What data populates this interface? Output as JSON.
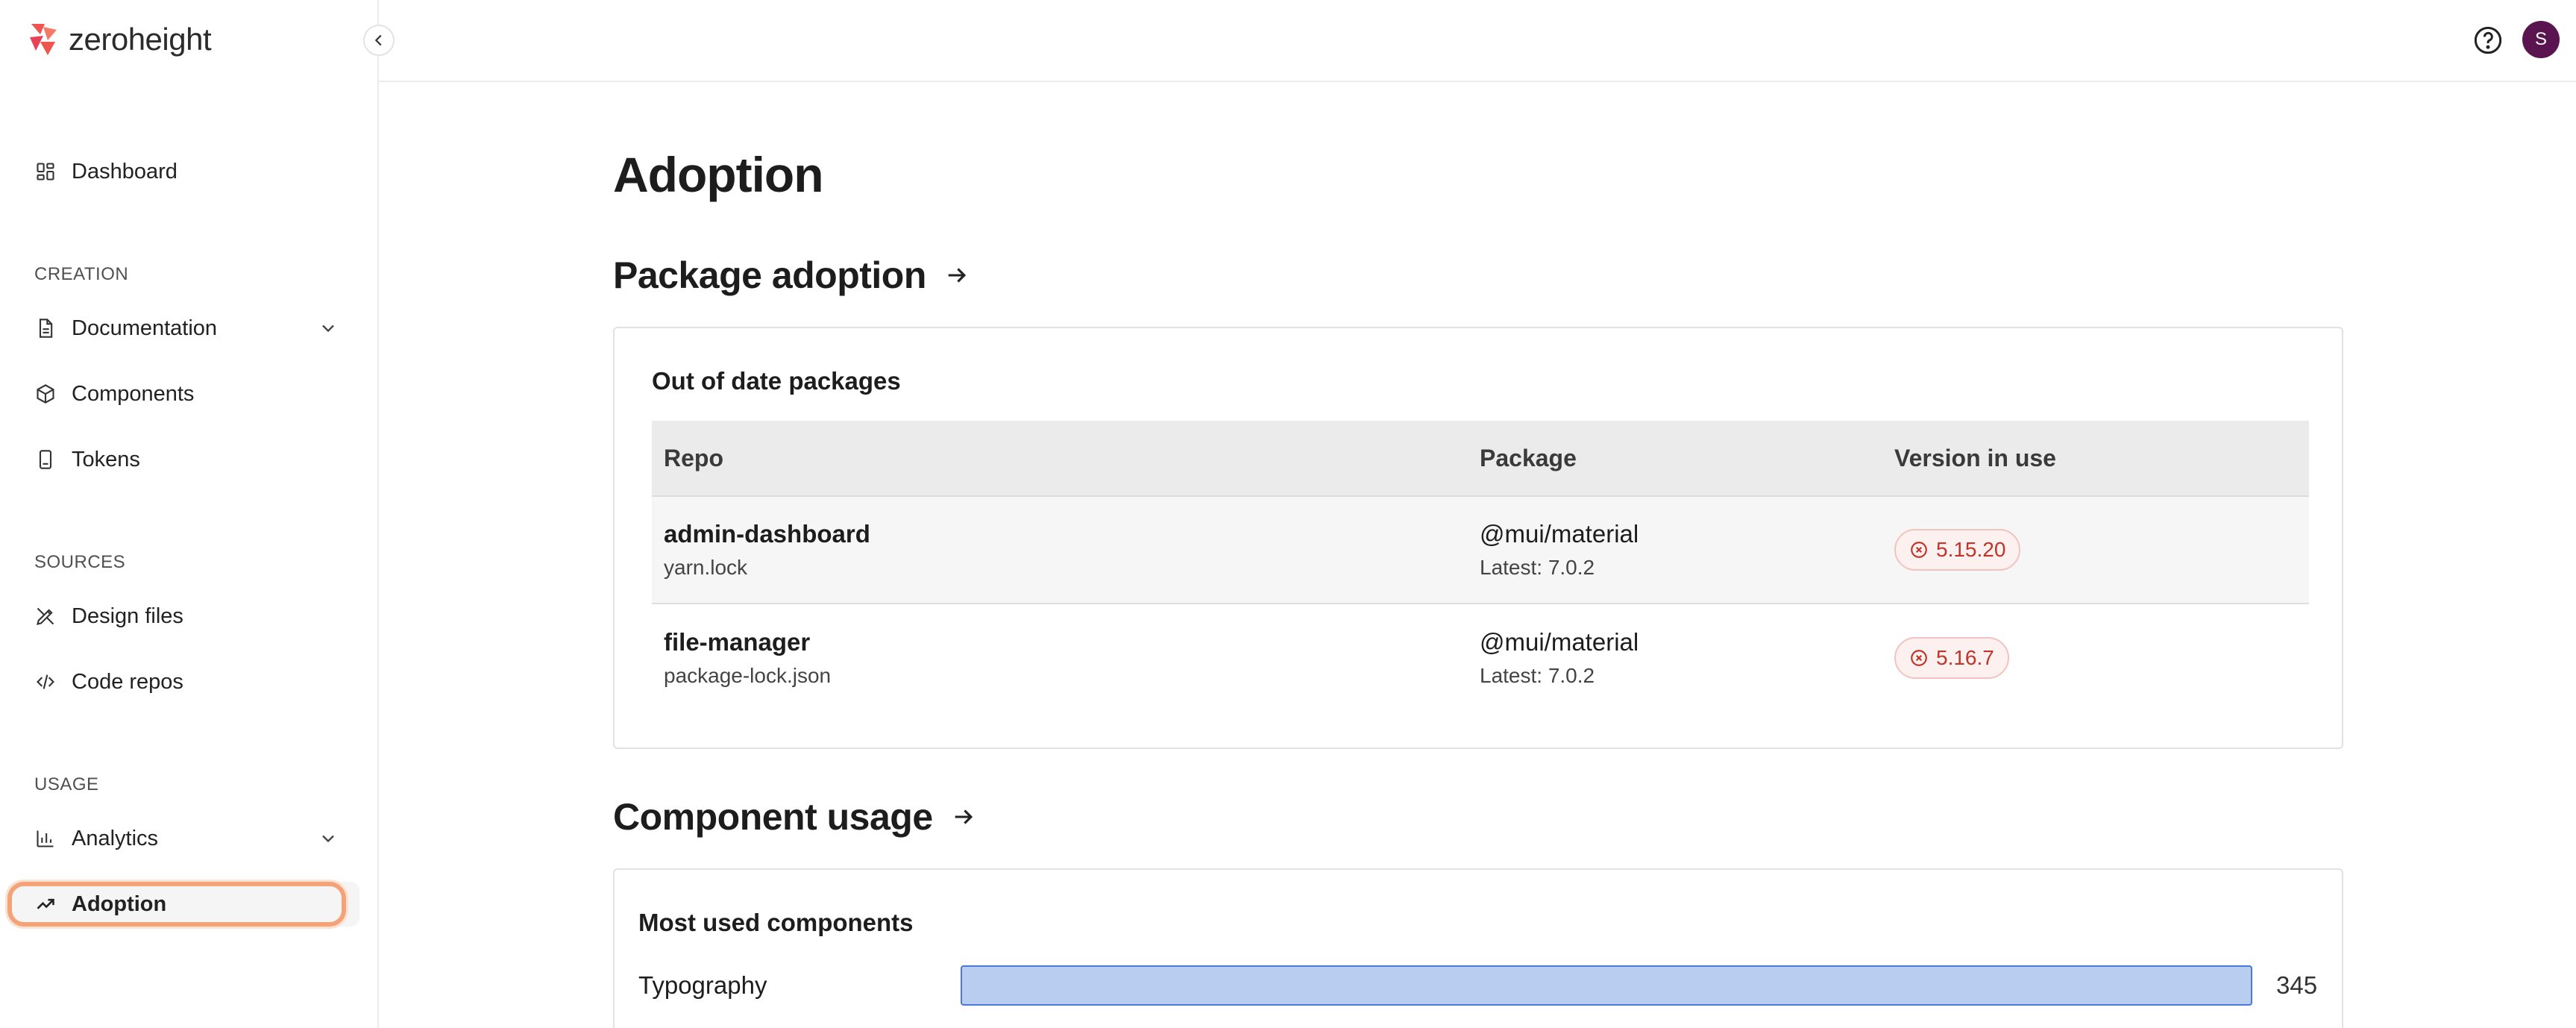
{
  "app": {
    "logo_text": "zeroheight"
  },
  "sidebar": {
    "dashboard": "Dashboard",
    "creation_label": "CREATION",
    "documentation": "Documentation",
    "components": "Components",
    "tokens": "Tokens",
    "sources_label": "SOURCES",
    "design_files": "Design files",
    "code_repos": "Code repos",
    "usage_label": "USAGE",
    "analytics": "Analytics",
    "adoption": "Adoption"
  },
  "topbar": {
    "avatar_initial": "S"
  },
  "main": {
    "title": "Adoption",
    "package_heading": "Package adoption",
    "component_heading": "Component usage",
    "packages_card": {
      "title": "Out of date packages",
      "headers": {
        "repo": "Repo",
        "package": "Package",
        "version": "Version in use"
      },
      "rows": [
        {
          "repo": "admin-dashboard",
          "lockfile": "yarn.lock",
          "package": "@mui/material",
          "latest": "Latest: 7.0.2",
          "version": "5.15.20"
        },
        {
          "repo": "file-manager",
          "lockfile": "package-lock.json",
          "package": "@mui/material",
          "latest": "Latest: 7.0.2",
          "version": "5.16.7"
        }
      ]
    },
    "components_card": {
      "title": "Most used components",
      "bars": [
        {
          "label": "Typography",
          "value": "345",
          "fraction": 1.0
        }
      ]
    }
  },
  "colors": {
    "accent_ring": "#f4a378",
    "avatar_bg": "#5a1450",
    "bar_fill": "#b9cdf0",
    "bar_border": "#4a79d6",
    "badge_text": "#c0342b"
  }
}
